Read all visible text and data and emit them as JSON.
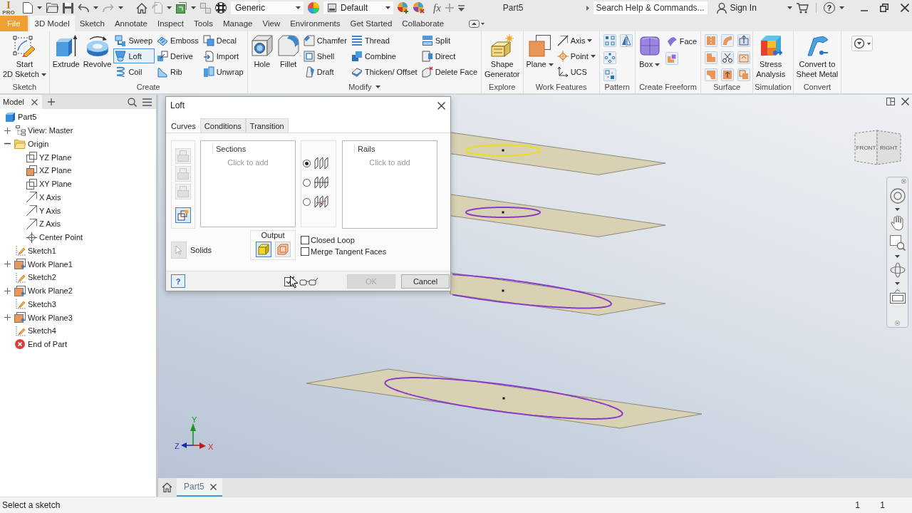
{
  "app_logo": {
    "letter": "I",
    "edition": "PRO"
  },
  "quick_access": {
    "style": "Generic",
    "appearance": "Default",
    "formula": "fx"
  },
  "title": "Part5",
  "search": {
    "placeholder": "Search Help & Commands..."
  },
  "account": {
    "label": "Sign In"
  },
  "help": {
    "label": "?"
  },
  "ribbon_tabs": [
    {
      "label": "File",
      "kind": "file",
      "selected": false
    },
    {
      "label": "3D Model",
      "kind": "tab",
      "selected": true
    },
    {
      "label": "Sketch",
      "kind": "tab",
      "selected": false
    },
    {
      "label": "Annotate",
      "kind": "tab",
      "selected": false
    },
    {
      "label": "Inspect",
      "kind": "tab",
      "selected": false
    },
    {
      "label": "Tools",
      "kind": "tab",
      "selected": false
    },
    {
      "label": "Manage",
      "kind": "tab",
      "selected": false
    },
    {
      "label": "View",
      "kind": "tab",
      "selected": false
    },
    {
      "label": "Environments",
      "kind": "tab",
      "selected": false
    },
    {
      "label": "Get Started",
      "kind": "tab",
      "selected": false
    },
    {
      "label": "Collaborate",
      "kind": "tab",
      "selected": false
    }
  ],
  "ribbon_panels": [
    {
      "label": "Sketch",
      "dropdown": false,
      "tools": [
        {
          "label": "Start\n2D Sketch",
          "kind": "large",
          "dropdown": true,
          "active": false
        }
      ]
    },
    {
      "label": "Create",
      "dropdown": false,
      "tools": [
        {
          "label": "Extrude",
          "kind": "large",
          "dropdown": false,
          "active": false
        },
        {
          "label": "Revolve",
          "kind": "large",
          "dropdown": false,
          "active": false
        },
        {
          "label": "Sweep",
          "kind": "small",
          "dropdown": false,
          "active": false
        },
        {
          "label": "Loft",
          "kind": "small",
          "dropdown": false,
          "active": true
        },
        {
          "label": "Coil",
          "kind": "small",
          "dropdown": false,
          "active": false
        },
        {
          "label": "Emboss",
          "kind": "small",
          "dropdown": false,
          "active": false
        },
        {
          "label": "Derive",
          "kind": "small",
          "dropdown": false,
          "active": false
        },
        {
          "label": "Rib",
          "kind": "small",
          "dropdown": false,
          "active": false
        },
        {
          "label": "Decal",
          "kind": "small",
          "dropdown": false,
          "active": false
        },
        {
          "label": "Import",
          "kind": "small",
          "dropdown": false,
          "active": false
        },
        {
          "label": "Unwrap",
          "kind": "small",
          "dropdown": false,
          "active": false
        }
      ]
    },
    {
      "label": "Modify",
      "dropdown": true,
      "tools": [
        {
          "label": "Hole",
          "kind": "large",
          "dropdown": false,
          "active": false
        },
        {
          "label": "Fillet",
          "kind": "large",
          "dropdown": false,
          "active": false
        },
        {
          "label": "Chamfer",
          "kind": "small",
          "dropdown": false,
          "active": false
        },
        {
          "label": "Shell",
          "kind": "small",
          "dropdown": false,
          "active": false
        },
        {
          "label": "Draft",
          "kind": "small",
          "dropdown": false,
          "active": false
        },
        {
          "label": "Thread",
          "kind": "small",
          "dropdown": false,
          "active": false
        },
        {
          "label": "Combine",
          "kind": "small",
          "dropdown": false,
          "active": false
        },
        {
          "label": "Thicken/ Offset",
          "kind": "small",
          "dropdown": false,
          "active": false
        },
        {
          "label": "Split",
          "kind": "small",
          "dropdown": false,
          "active": false
        },
        {
          "label": "Direct",
          "kind": "small",
          "dropdown": false,
          "active": false
        },
        {
          "label": "Delete Face",
          "kind": "small",
          "dropdown": false,
          "active": false
        }
      ]
    },
    {
      "label": "Explore",
      "dropdown": false,
      "tools": [
        {
          "label": "Shape\nGenerator",
          "kind": "large",
          "dropdown": false,
          "active": false
        }
      ]
    },
    {
      "label": "Work Features",
      "dropdown": false,
      "tools": [
        {
          "label": "Plane",
          "kind": "large",
          "dropdown": true,
          "active": false
        },
        {
          "label": "Axis",
          "kind": "small",
          "dropdown": true,
          "active": false
        },
        {
          "label": "Point",
          "kind": "small",
          "dropdown": true,
          "active": false
        },
        {
          "label": "UCS",
          "kind": "small",
          "dropdown": false,
          "active": false
        }
      ]
    },
    {
      "label": "Pattern",
      "dropdown": false,
      "tools": [
        {
          "kind": "icon",
          "dropdown": false,
          "active": false
        },
        {
          "kind": "icon",
          "dropdown": false,
          "active": false
        },
        {
          "kind": "icon",
          "dropdown": false,
          "active": false
        },
        {
          "kind": "icon",
          "dropdown": false,
          "active": false
        }
      ]
    },
    {
      "label": "Create Freeform",
      "dropdown": false,
      "tools": [
        {
          "label": "Box",
          "kind": "large",
          "dropdown": true,
          "active": false
        },
        {
          "label": "Face",
          "kind": "small",
          "dropdown": false,
          "active": false
        },
        {
          "kind": "icon",
          "dropdown": false,
          "active": false
        }
      ]
    },
    {
      "label": "Surface",
      "dropdown": false,
      "tools": [
        {
          "kind": "icon",
          "dropdown": false,
          "active": false
        },
        {
          "kind": "icon",
          "dropdown": false,
          "active": false
        },
        {
          "kind": "icon",
          "dropdown": false,
          "active": false
        },
        {
          "kind": "icon",
          "dropdown": false,
          "active": false
        },
        {
          "kind": "icon",
          "dropdown": false,
          "active": false
        },
        {
          "kind": "icon",
          "dropdown": false,
          "active": false
        },
        {
          "kind": "icon",
          "dropdown": false,
          "active": false
        },
        {
          "kind": "icon",
          "dropdown": false,
          "active": false
        },
        {
          "kind": "icon",
          "dropdown": false,
          "active": false
        }
      ]
    },
    {
      "label": "Simulation",
      "dropdown": false,
      "tools": [
        {
          "label": "Stress\nAnalysis",
          "kind": "large",
          "dropdown": false,
          "active": false
        }
      ]
    },
    {
      "label": "Convert",
      "dropdown": false,
      "tools": [
        {
          "label": "Convert to\nSheet Metal",
          "kind": "large",
          "dropdown": false,
          "active": false
        }
      ]
    }
  ],
  "browser": {
    "tab": "Model",
    "tree": [
      {
        "label": "Part5",
        "kind": "part",
        "children": [
          {
            "label": "View: Master",
            "kind": "view",
            "expanded": false
          },
          {
            "label": "Origin",
            "kind": "folder",
            "expanded": true,
            "children": [
              {
                "label": "YZ Plane",
                "kind": "plane",
                "visible": false
              },
              {
                "label": "XZ Plane",
                "kind": "plane",
                "visible": true
              },
              {
                "label": "XY Plane",
                "kind": "plane",
                "visible": false
              },
              {
                "label": "X Axis",
                "kind": "axis"
              },
              {
                "label": "Y Axis",
                "kind": "axis"
              },
              {
                "label": "Z Axis",
                "kind": "axis"
              },
              {
                "label": "Center Point",
                "kind": "point"
              }
            ]
          },
          {
            "label": "Sketch1",
            "kind": "sketch"
          },
          {
            "label": "Work Plane1",
            "kind": "work_plane",
            "expanded": false,
            "visible": true
          },
          {
            "label": "Sketch2",
            "kind": "sketch"
          },
          {
            "label": "Work Plane2",
            "kind": "work_plane",
            "expanded": false,
            "visible": true
          },
          {
            "label": "Sketch3",
            "kind": "sketch"
          },
          {
            "label": "Work Plane3",
            "kind": "work_plane",
            "expanded": false,
            "visible": true
          },
          {
            "label": "Sketch4",
            "kind": "sketch"
          },
          {
            "label": "End of Part",
            "kind": "end"
          }
        ]
      }
    ]
  },
  "loft_dialog": {
    "title": "Loft",
    "tabs": [
      {
        "label": "Curves",
        "selected": true
      },
      {
        "label": "Conditions",
        "selected": false
      },
      {
        "label": "Transition",
        "selected": false
      }
    ],
    "section_tools": [
      {
        "disabled": true
      },
      {
        "disabled": true
      },
      {
        "disabled": true
      },
      {
        "disabled": false
      }
    ],
    "sections": {
      "header": "Sections",
      "placeholder": "Click to add"
    },
    "loft_types": [
      {
        "selected": true
      },
      {
        "selected": false
      },
      {
        "selected": false
      }
    ],
    "rails": {
      "header": "Rails",
      "placeholder": "Click to add"
    },
    "solids": {
      "label": "Solids",
      "disabled": true
    },
    "output": {
      "label": "Output",
      "options": [
        {
          "kind": "solid",
          "selected": true
        },
        {
          "kind": "surface",
          "selected": false
        }
      ]
    },
    "options": [
      {
        "label": "Closed Loop",
        "checked": false
      },
      {
        "label": "Merge Tangent Faces",
        "checked": false
      }
    ],
    "help_button": "?",
    "buttons": [
      {
        "label": "OK",
        "disabled": true
      },
      {
        "label": "Cancel",
        "disabled": false
      }
    ]
  },
  "viewcube": {
    "faces": [
      "FRONT",
      "RIGHT"
    ]
  },
  "triad": {
    "labels": [
      "Y",
      "Z",
      "X"
    ]
  },
  "document_tabs": [
    {
      "label": "Part5",
      "selected": true
    }
  ],
  "status_bar": {
    "message": "Select a sketch",
    "counters": [
      "1",
      "1"
    ]
  }
}
